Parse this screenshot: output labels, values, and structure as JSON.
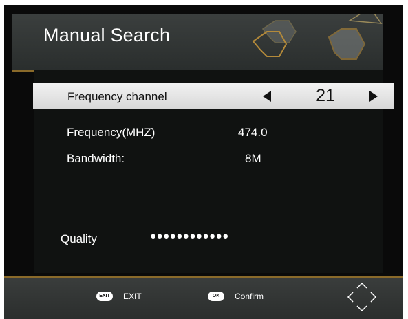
{
  "header": {
    "title": "Manual Search"
  },
  "selected_row": {
    "label": "Frequency channel",
    "value": "21"
  },
  "info": [
    {
      "label": "Frequency(MHZ)",
      "value": "474.0"
    },
    {
      "label": "Bandwidth:",
      "value": "8M"
    }
  ],
  "quality": {
    "label": "Quality",
    "dots": "●●●●●●●●●●●●",
    "level": 12
  },
  "footer": {
    "exit_key": "EXIT",
    "exit_label": "EXIT",
    "ok_key": "OK",
    "confirm_label": "Confirm"
  },
  "colors": {
    "accent": "#8a6a2a",
    "background": "#0a0a0a",
    "panel": "#2f3332",
    "highlight": "#e6e6e6"
  },
  "icons": [
    "left-arrow-icon",
    "right-arrow-icon",
    "exit-key-icon",
    "ok-key-icon",
    "navigation-arrows-icon",
    "hexagon-decoration-icon"
  ]
}
